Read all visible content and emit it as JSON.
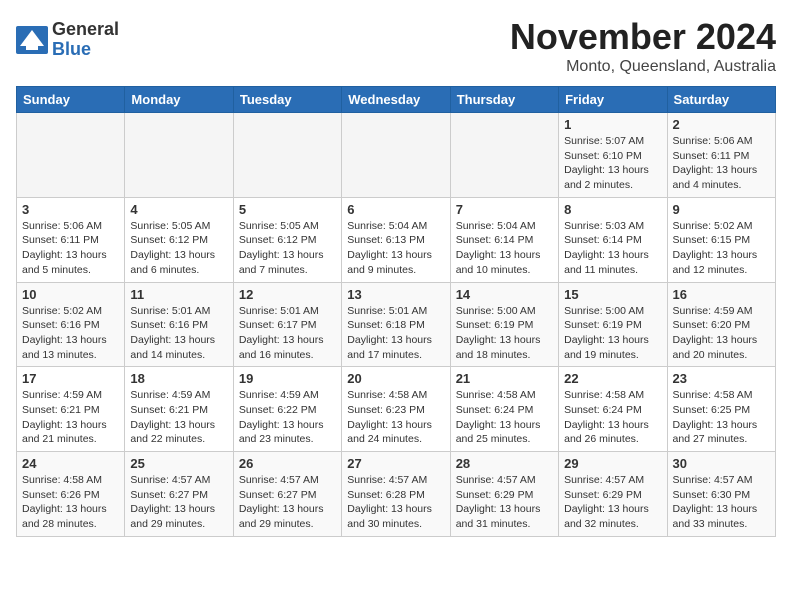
{
  "header": {
    "logo_general": "General",
    "logo_blue": "Blue",
    "month_title": "November 2024",
    "location": "Monto, Queensland, Australia"
  },
  "weekdays": [
    "Sunday",
    "Monday",
    "Tuesday",
    "Wednesday",
    "Thursday",
    "Friday",
    "Saturday"
  ],
  "weeks": [
    [
      {
        "day": "",
        "info": ""
      },
      {
        "day": "",
        "info": ""
      },
      {
        "day": "",
        "info": ""
      },
      {
        "day": "",
        "info": ""
      },
      {
        "day": "",
        "info": ""
      },
      {
        "day": "1",
        "info": "Sunrise: 5:07 AM\nSunset: 6:10 PM\nDaylight: 13 hours and 2 minutes."
      },
      {
        "day": "2",
        "info": "Sunrise: 5:06 AM\nSunset: 6:11 PM\nDaylight: 13 hours and 4 minutes."
      }
    ],
    [
      {
        "day": "3",
        "info": "Sunrise: 5:06 AM\nSunset: 6:11 PM\nDaylight: 13 hours and 5 minutes."
      },
      {
        "day": "4",
        "info": "Sunrise: 5:05 AM\nSunset: 6:12 PM\nDaylight: 13 hours and 6 minutes."
      },
      {
        "day": "5",
        "info": "Sunrise: 5:05 AM\nSunset: 6:12 PM\nDaylight: 13 hours and 7 minutes."
      },
      {
        "day": "6",
        "info": "Sunrise: 5:04 AM\nSunset: 6:13 PM\nDaylight: 13 hours and 9 minutes."
      },
      {
        "day": "7",
        "info": "Sunrise: 5:04 AM\nSunset: 6:14 PM\nDaylight: 13 hours and 10 minutes."
      },
      {
        "day": "8",
        "info": "Sunrise: 5:03 AM\nSunset: 6:14 PM\nDaylight: 13 hours and 11 minutes."
      },
      {
        "day": "9",
        "info": "Sunrise: 5:02 AM\nSunset: 6:15 PM\nDaylight: 13 hours and 12 minutes."
      }
    ],
    [
      {
        "day": "10",
        "info": "Sunrise: 5:02 AM\nSunset: 6:16 PM\nDaylight: 13 hours and 13 minutes."
      },
      {
        "day": "11",
        "info": "Sunrise: 5:01 AM\nSunset: 6:16 PM\nDaylight: 13 hours and 14 minutes."
      },
      {
        "day": "12",
        "info": "Sunrise: 5:01 AM\nSunset: 6:17 PM\nDaylight: 13 hours and 16 minutes."
      },
      {
        "day": "13",
        "info": "Sunrise: 5:01 AM\nSunset: 6:18 PM\nDaylight: 13 hours and 17 minutes."
      },
      {
        "day": "14",
        "info": "Sunrise: 5:00 AM\nSunset: 6:19 PM\nDaylight: 13 hours and 18 minutes."
      },
      {
        "day": "15",
        "info": "Sunrise: 5:00 AM\nSunset: 6:19 PM\nDaylight: 13 hours and 19 minutes."
      },
      {
        "day": "16",
        "info": "Sunrise: 4:59 AM\nSunset: 6:20 PM\nDaylight: 13 hours and 20 minutes."
      }
    ],
    [
      {
        "day": "17",
        "info": "Sunrise: 4:59 AM\nSunset: 6:21 PM\nDaylight: 13 hours and 21 minutes."
      },
      {
        "day": "18",
        "info": "Sunrise: 4:59 AM\nSunset: 6:21 PM\nDaylight: 13 hours and 22 minutes."
      },
      {
        "day": "19",
        "info": "Sunrise: 4:59 AM\nSunset: 6:22 PM\nDaylight: 13 hours and 23 minutes."
      },
      {
        "day": "20",
        "info": "Sunrise: 4:58 AM\nSunset: 6:23 PM\nDaylight: 13 hours and 24 minutes."
      },
      {
        "day": "21",
        "info": "Sunrise: 4:58 AM\nSunset: 6:24 PM\nDaylight: 13 hours and 25 minutes."
      },
      {
        "day": "22",
        "info": "Sunrise: 4:58 AM\nSunset: 6:24 PM\nDaylight: 13 hours and 26 minutes."
      },
      {
        "day": "23",
        "info": "Sunrise: 4:58 AM\nSunset: 6:25 PM\nDaylight: 13 hours and 27 minutes."
      }
    ],
    [
      {
        "day": "24",
        "info": "Sunrise: 4:58 AM\nSunset: 6:26 PM\nDaylight: 13 hours and 28 minutes."
      },
      {
        "day": "25",
        "info": "Sunrise: 4:57 AM\nSunset: 6:27 PM\nDaylight: 13 hours and 29 minutes."
      },
      {
        "day": "26",
        "info": "Sunrise: 4:57 AM\nSunset: 6:27 PM\nDaylight: 13 hours and 29 minutes."
      },
      {
        "day": "27",
        "info": "Sunrise: 4:57 AM\nSunset: 6:28 PM\nDaylight: 13 hours and 30 minutes."
      },
      {
        "day": "28",
        "info": "Sunrise: 4:57 AM\nSunset: 6:29 PM\nDaylight: 13 hours and 31 minutes."
      },
      {
        "day": "29",
        "info": "Sunrise: 4:57 AM\nSunset: 6:29 PM\nDaylight: 13 hours and 32 minutes."
      },
      {
        "day": "30",
        "info": "Sunrise: 4:57 AM\nSunset: 6:30 PM\nDaylight: 13 hours and 33 minutes."
      }
    ]
  ]
}
